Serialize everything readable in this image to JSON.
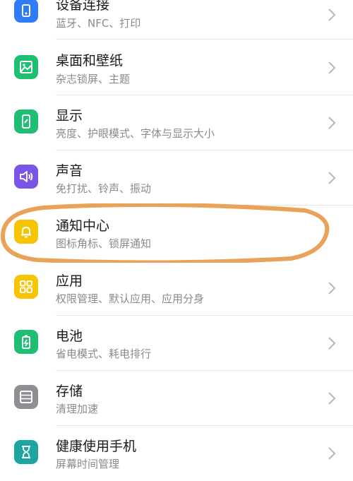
{
  "settings": {
    "items": [
      {
        "title": "设备连接",
        "subtitle": "蓝牙、NFC、打印",
        "icon": "device-connection-icon",
        "color": "#2f7cf6"
      },
      {
        "title": "桌面和壁纸",
        "subtitle": "杂志锁屏、主题",
        "icon": "wallpaper-icon",
        "color": "#1fbf73"
      },
      {
        "title": "显示",
        "subtitle": "亮度、护眼模式、字体与显示大小",
        "icon": "display-icon",
        "color": "#1fbf73"
      },
      {
        "title": "声音",
        "subtitle": "免打扰、铃声、振动",
        "icon": "sound-icon",
        "color": "#7a55e8"
      },
      {
        "title": "通知中心",
        "subtitle": "图标角标、锁屏通知",
        "icon": "bell-icon",
        "color": "#f6c400"
      },
      {
        "title": "应用",
        "subtitle": "权限管理、默认应用、应用分身",
        "icon": "apps-grid-icon",
        "color": "#f6c400"
      },
      {
        "title": "电池",
        "subtitle": "省电模式、耗电排行",
        "icon": "battery-icon",
        "color": "#1fbf73"
      },
      {
        "title": "存储",
        "subtitle": "清理加速",
        "icon": "storage-icon",
        "color": "#8e8e93"
      },
      {
        "title": "健康使用手机",
        "subtitle": "屏幕时间管理",
        "icon": "hourglass-icon",
        "color": "#1fa5a0"
      }
    ],
    "highlight_color": "#e9a25a"
  }
}
